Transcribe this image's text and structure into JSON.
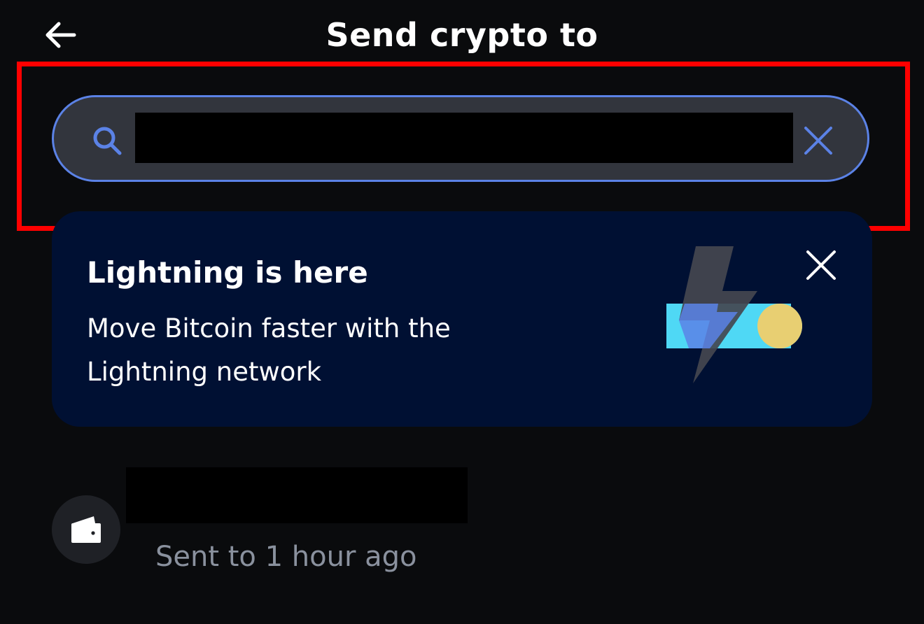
{
  "header": {
    "title": "Send crypto to"
  },
  "search": {
    "value": "",
    "placeholder": ""
  },
  "promo": {
    "title": "Lightning is here",
    "body_line1": "Move Bitcoin faster with the",
    "body_line2": "Lightning network"
  },
  "recent": [
    {
      "name": "",
      "subtitle": "Sent to 1 hour ago",
      "icon": "wallet-icon"
    }
  ],
  "colors": {
    "background": "#0a0b0d",
    "search_field": "#32353d",
    "accent_blue": "#5b82e6",
    "promo_card": "#001033",
    "bolt_gray": "#44474f",
    "toggle_cyan": "#4fd8f5",
    "toggle_knob": "#e8cf72",
    "muted_text": "#8a919e",
    "highlight": "#ff0000"
  }
}
